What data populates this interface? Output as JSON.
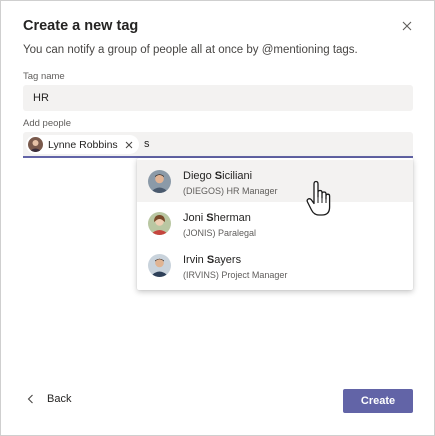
{
  "dialog": {
    "title": "Create a new tag",
    "subtitle": "You can notify a group of people all at once by @mentioning tags.",
    "close_icon": "close-icon"
  },
  "tag_name": {
    "label": "Tag name",
    "value": "HR"
  },
  "add_people": {
    "label": "Add people",
    "selected": [
      {
        "name": "Lynne Robbins"
      }
    ],
    "query": "s"
  },
  "suggestions": [
    {
      "name_before": "Diego ",
      "name_match": "S",
      "name_after": "iciliani",
      "detail": "(DIEGOS) HR Manager",
      "hovered": true
    },
    {
      "name_before": "Joni ",
      "name_match": "S",
      "name_after": "herman",
      "detail": "(JONIS) Paralegal",
      "hovered": false
    },
    {
      "name_before": "Irvin ",
      "name_match": "S",
      "name_after": "ayers",
      "detail": "(IRVINS) Project Manager",
      "hovered": false
    }
  ],
  "footer": {
    "back_label": "Back",
    "create_label": "Create"
  },
  "colors": {
    "accent": "#6264a7",
    "input_bg": "#f3f2f1",
    "hover_bg": "#f3f2f1"
  }
}
